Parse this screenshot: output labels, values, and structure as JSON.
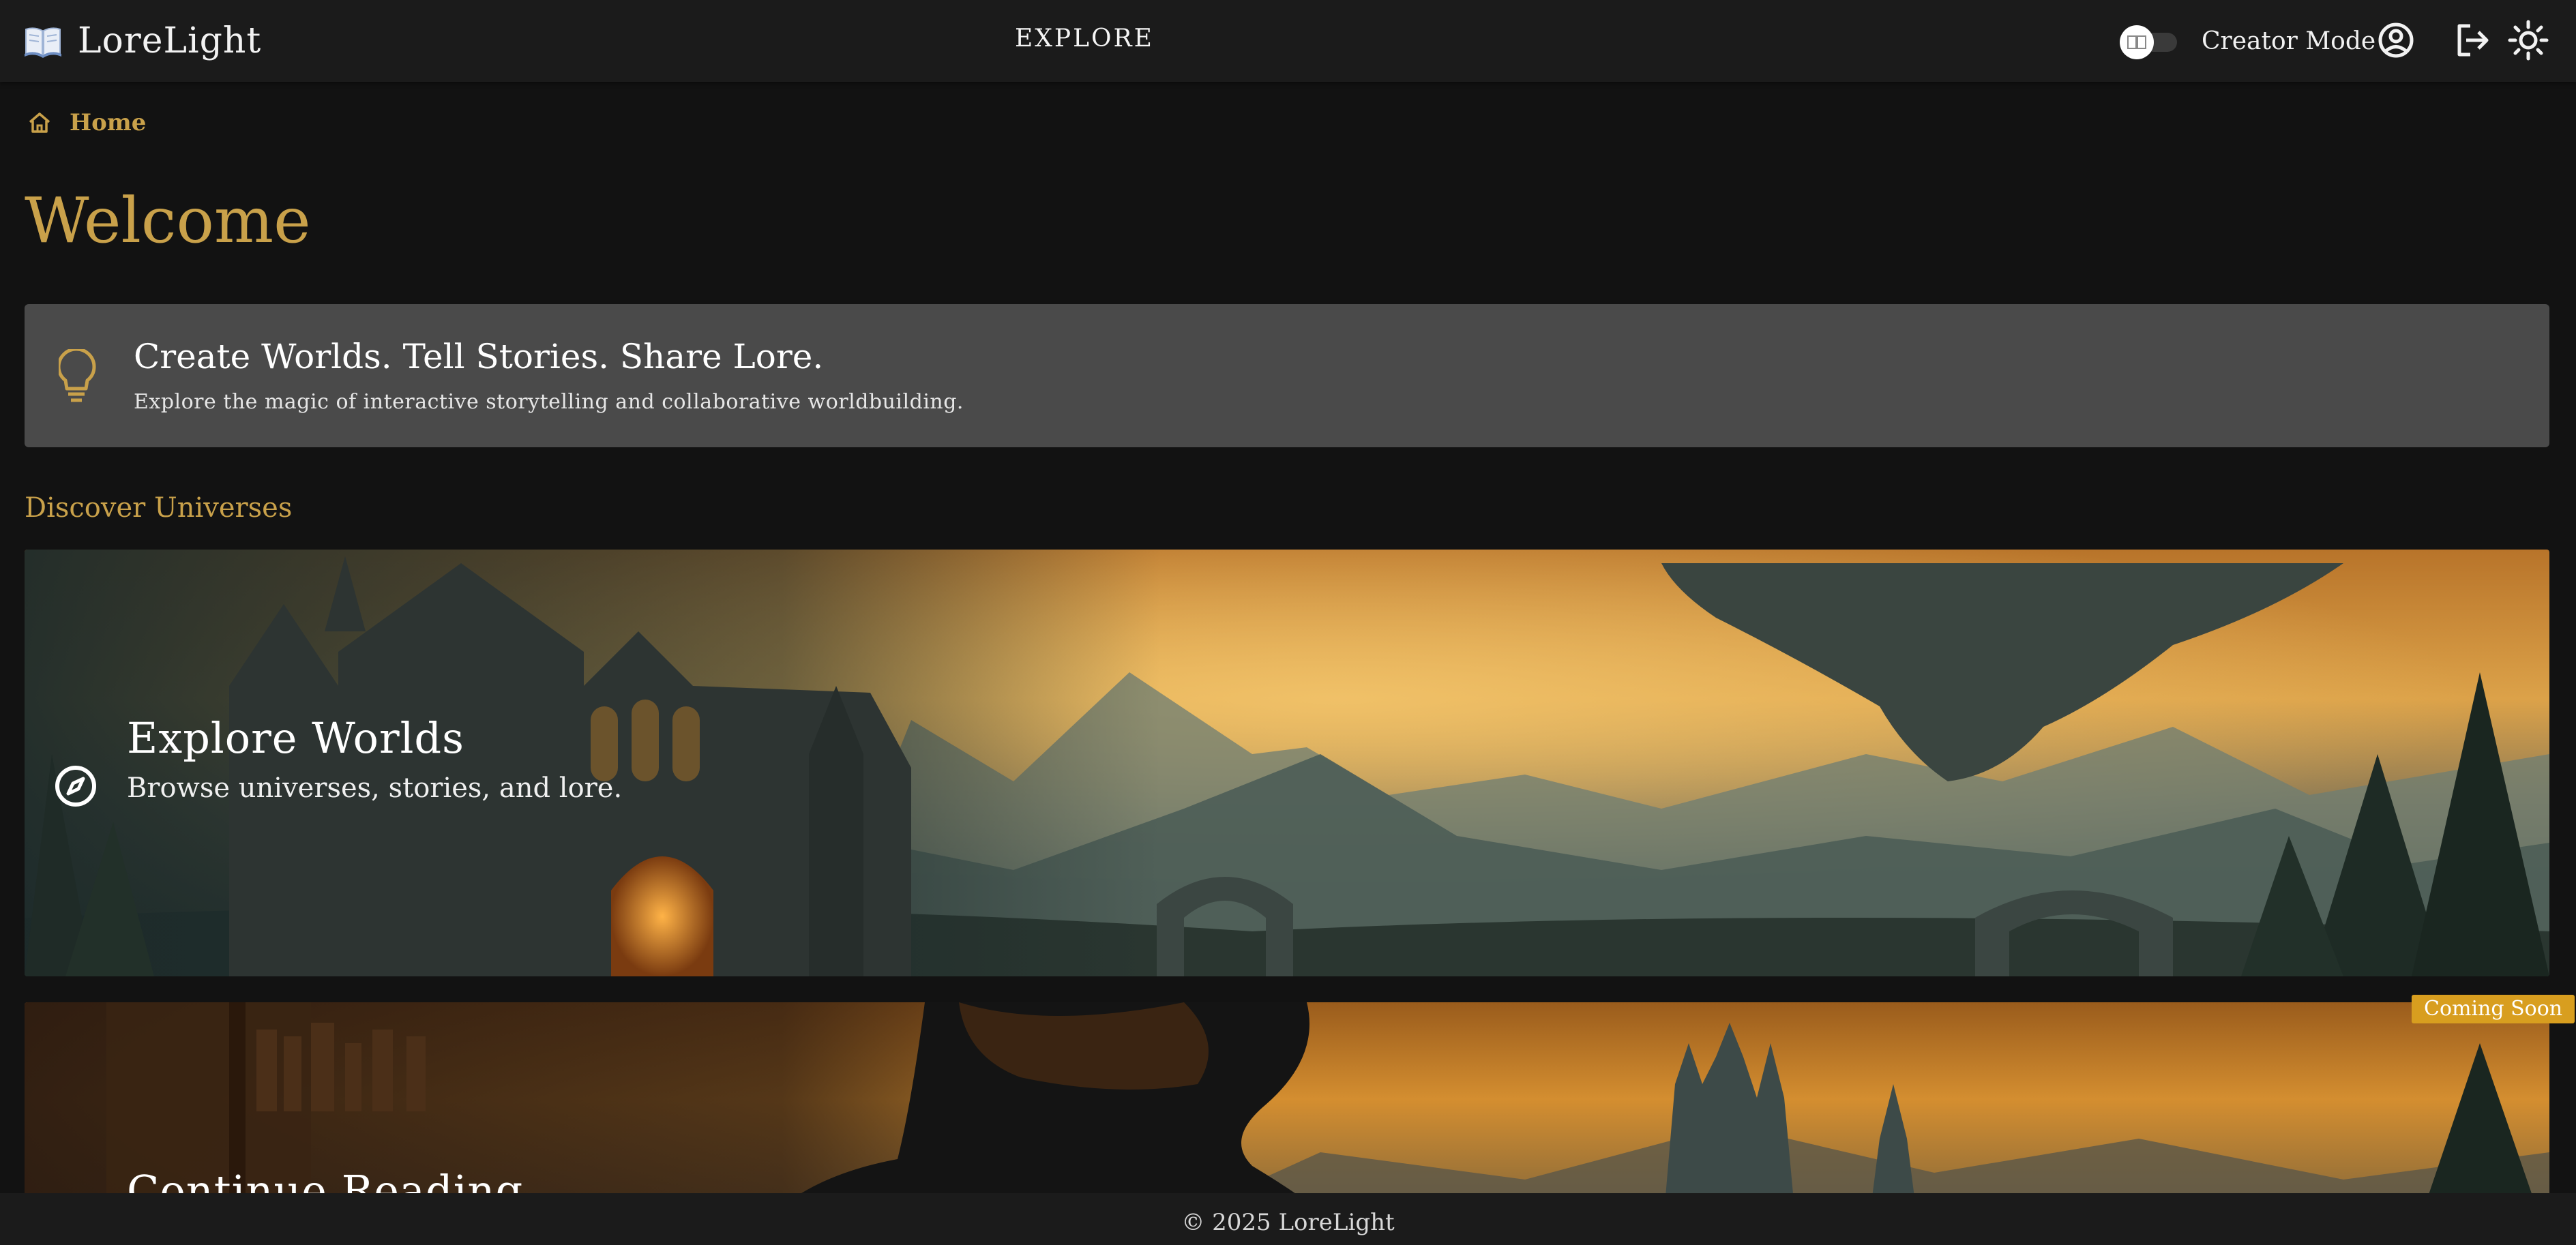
{
  "header": {
    "brand_name": "LoreLight",
    "brand_icon": "open-book-icon",
    "nav_explore": "EXPLORE",
    "creator_mode_label": "Creator Mode",
    "icons": [
      "account-circle-icon",
      "logout-icon",
      "sun-icon"
    ]
  },
  "breadcrumb": {
    "home_label": "Home",
    "icon": "home-icon"
  },
  "page": {
    "title": "Welcome"
  },
  "tip": {
    "icon": "lightbulb-icon",
    "heading": "Create Worlds. Tell Stories. Share Lore.",
    "subtext": "Explore the magic of interactive storytelling and collaborative worldbuilding."
  },
  "discover": {
    "section_title": "Discover Universes",
    "cards": [
      {
        "title": "Explore Worlds",
        "subtitle": "Browse universes, stories, and lore.",
        "icon": "compass-icon"
      },
      {
        "title": "Continue Reading",
        "badge": "Coming Soon"
      }
    ]
  },
  "footer": {
    "text": "© 2025 LoreLight"
  },
  "colors": {
    "accent": "#c9a14a",
    "badge": "#d89e1f",
    "background": "#121212",
    "bar": "#1b1b1b",
    "tip_bg": "#4a4a4a"
  }
}
